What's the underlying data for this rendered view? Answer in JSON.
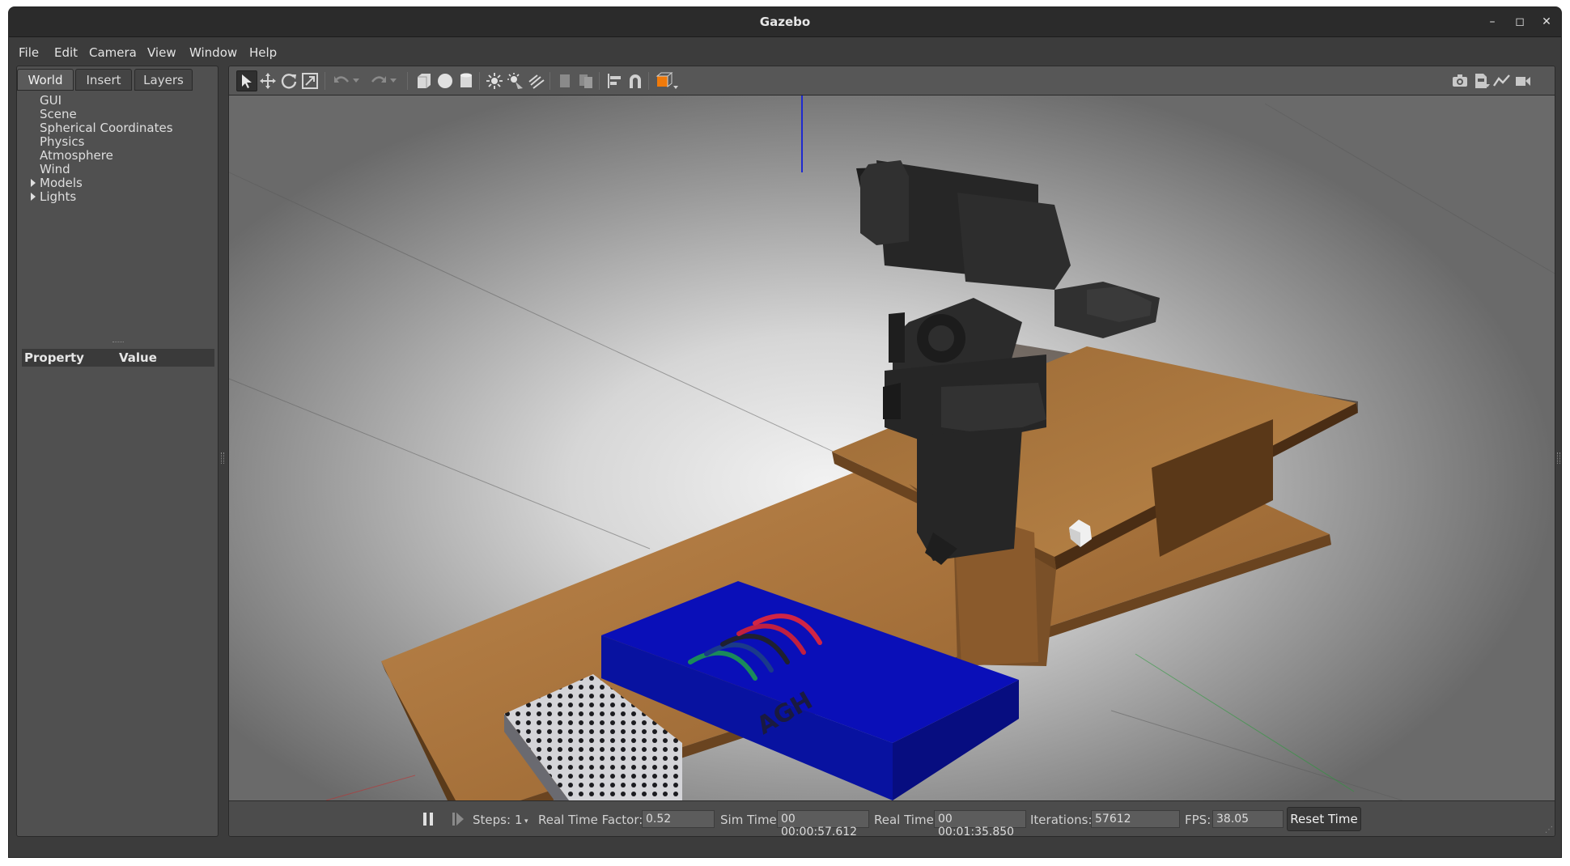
{
  "window": {
    "title": "Gazebo"
  },
  "menubar": [
    "File",
    "Edit",
    "Camera",
    "View",
    "Window",
    "Help"
  ],
  "left_panel": {
    "tabs": [
      "World",
      "Insert",
      "Layers"
    ],
    "active_tab": "World",
    "tree": [
      {
        "label": "GUI",
        "expandable": false
      },
      {
        "label": "Scene",
        "expandable": false
      },
      {
        "label": "Spherical Coordinates",
        "expandable": false
      },
      {
        "label": "Physics",
        "expandable": false
      },
      {
        "label": "Atmosphere",
        "expandable": false
      },
      {
        "label": "Wind",
        "expandable": false
      },
      {
        "label": "Models",
        "expandable": true
      },
      {
        "label": "Lights",
        "expandable": true
      }
    ],
    "property_header": {
      "property": "Property",
      "value": "Value"
    }
  },
  "toolbar": {
    "tools": [
      "select-mode",
      "translate-mode",
      "rotate-mode",
      "scale-mode",
      "undo",
      "redo",
      "box",
      "sphere",
      "cylinder",
      "point-light",
      "spot-light",
      "directional-light",
      "copy",
      "paste",
      "align",
      "snap",
      "change-view"
    ],
    "right_tools": [
      "screenshot",
      "log",
      "plot",
      "record-video"
    ]
  },
  "scene": {
    "logo_text": "AGH",
    "colors": {
      "box": "#0010c0",
      "wood": "#a27038",
      "robot": "#262626",
      "selected_accent": "#f07a0a"
    }
  },
  "statusbar": {
    "steps_label": "Steps:",
    "steps_value": "1",
    "rtf_label": "Real Time Factor:",
    "rtf_value": "0.52",
    "sim_time_label": "Sim Time:",
    "sim_time_value": "00 00:00:57.612",
    "real_time_label": "Real Time:",
    "real_time_value": "00 00:01:35.850",
    "iterations_label": "Iterations:",
    "iterations_value": "57612",
    "fps_label": "FPS:",
    "fps_value": "38.05",
    "reset_label": "Reset Time"
  }
}
